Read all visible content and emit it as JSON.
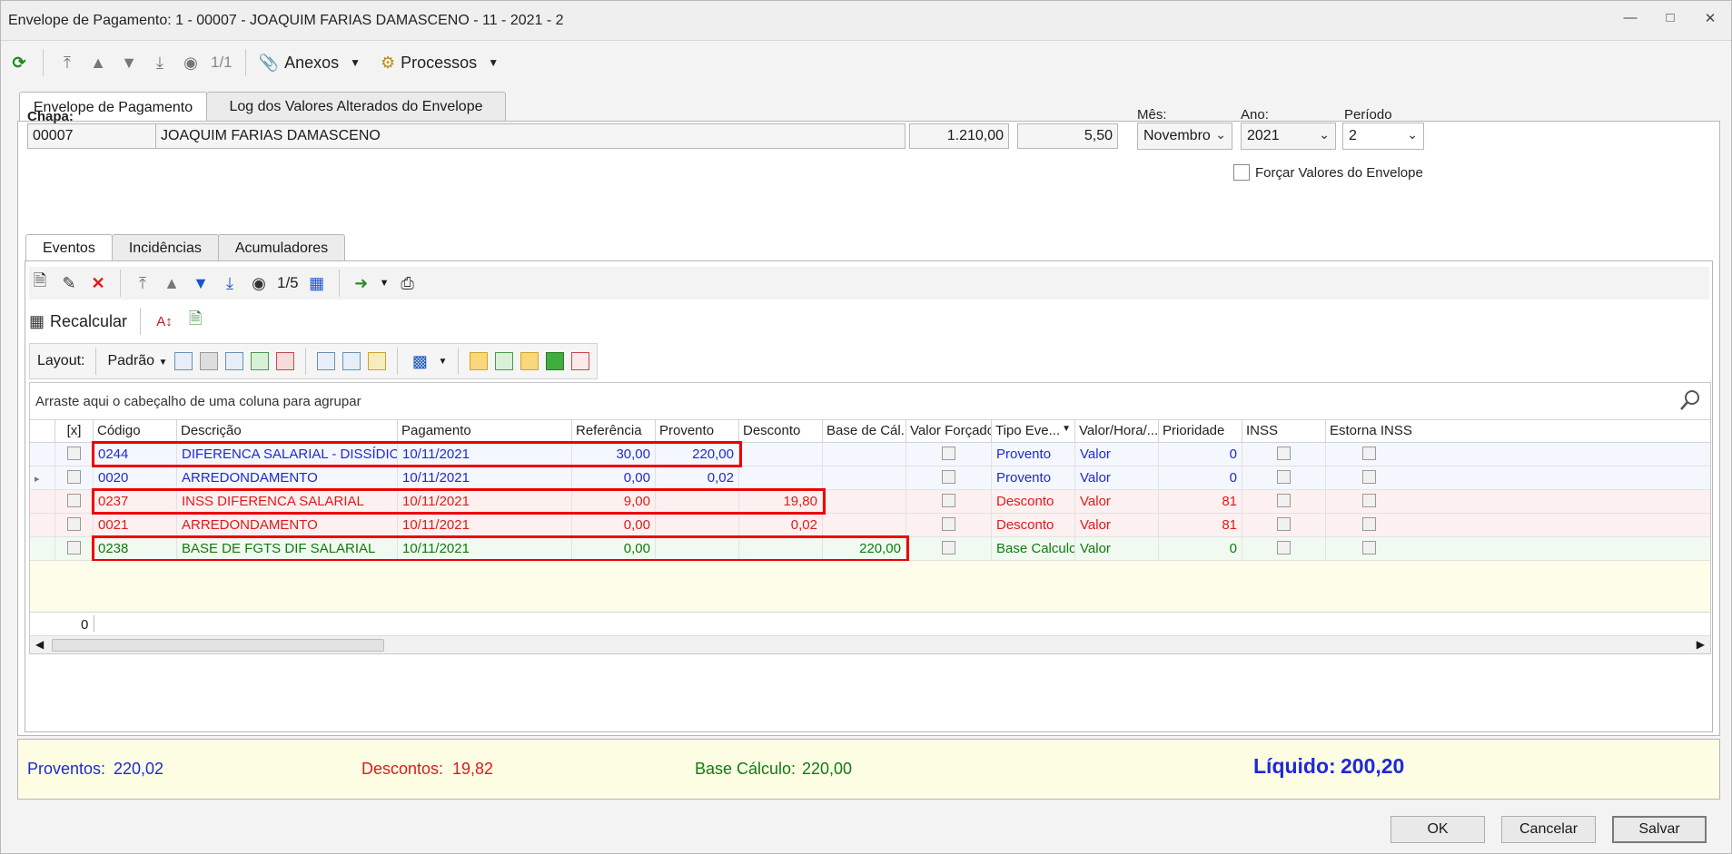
{
  "window": {
    "title": "Envelope de Pagamento: 1 - 00007 - JOAQUIM FARIAS DAMASCENO - 11 - 2021 - 2"
  },
  "toolbar": {
    "counter": "1/1",
    "anexos": "Anexos",
    "processos": "Processos"
  },
  "tabs": [
    "Envelope de Pagamento",
    "Log dos Valores Alterados do Envelope"
  ],
  "header": {
    "chapa_label": "Chapa:",
    "chapa": "00007",
    "nome": "JOAQUIM FARIAS DAMASCENO",
    "valor1": "1.210,00",
    "valor2": "5,50",
    "mes_label": "Mês:",
    "mes": "Novembro",
    "ano_label": "Ano:",
    "ano": "2021",
    "periodo_label": "Período",
    "periodo": "2",
    "forcar_label": "Forçar Valores do Envelope"
  },
  "subtabs": [
    "Eventos",
    "Incidências",
    "Acumuladores"
  ],
  "events_toolbar": {
    "counter": "1/5",
    "recalcular": "Recalcular"
  },
  "layout_toolbar": {
    "layout_label": "Layout:",
    "padrao": "Padrão"
  },
  "grid": {
    "group_hint": "Arraste aqui o cabeçalho de uma coluna para agrupar",
    "columns": [
      "[x]",
      "Código",
      "Descrição",
      "Pagamento",
      "Referência",
      "Provento",
      "Desconto",
      "Base de Cál...",
      "Valor Forçado",
      "Tipo Eve...",
      "Valor/Hora/...",
      "Prioridade",
      "INSS",
      "Estorna INSS"
    ],
    "rows": [
      {
        "codigo": "0244",
        "descricao": "DIFERENCA SALARIAL - DISSÍDIO",
        "pagamento": "10/11/2021",
        "referencia": "30,00",
        "provento": "220,00",
        "desconto": "",
        "base": "",
        "tipo": "Provento",
        "valor_hora": "Valor",
        "prioridade": "0"
      },
      {
        "codigo": "0020",
        "descricao": "ARREDONDAMENTO",
        "pagamento": "10/11/2021",
        "referencia": "0,00",
        "provento": "0,02",
        "desconto": "",
        "base": "",
        "tipo": "Provento",
        "valor_hora": "Valor",
        "prioridade": "0"
      },
      {
        "codigo": "0237",
        "descricao": "INSS DIFERENCA SALARIAL",
        "pagamento": "10/11/2021",
        "referencia": "9,00",
        "provento": "",
        "desconto": "19,80",
        "base": "",
        "tipo": "Desconto",
        "valor_hora": "Valor",
        "prioridade": "81"
      },
      {
        "codigo": "0021",
        "descricao": "ARREDONDAMENTO",
        "pagamento": "10/11/2021",
        "referencia": "0,00",
        "provento": "",
        "desconto": "0,02",
        "base": "",
        "tipo": "Desconto",
        "valor_hora": "Valor",
        "prioridade": "81"
      },
      {
        "codigo": "0238",
        "descricao": "BASE DE FGTS DIF SALARIAL",
        "pagamento": "10/11/2021",
        "referencia": "0,00",
        "provento": "",
        "desconto": "",
        "base": "220,00",
        "tipo": "Base Calculo",
        "valor_hora": "Valor",
        "prioridade": "0"
      }
    ],
    "footer_count": "0"
  },
  "summary": {
    "proventos_label": "Proventos:",
    "proventos": "220,02",
    "descontos_label": "Descontos:",
    "descontos": "19,82",
    "base_label": "Base Cálculo:",
    "base": "220,00",
    "liquido_label": "Líquido:",
    "liquido": "200,20"
  },
  "buttons": {
    "ok": "OK",
    "cancelar": "Cancelar",
    "salvar": "Salvar"
  },
  "colors": {
    "provento": "#1f29d6",
    "desconto": "#e01a1a",
    "base": "#117a11",
    "highlight": "#ee0000"
  }
}
